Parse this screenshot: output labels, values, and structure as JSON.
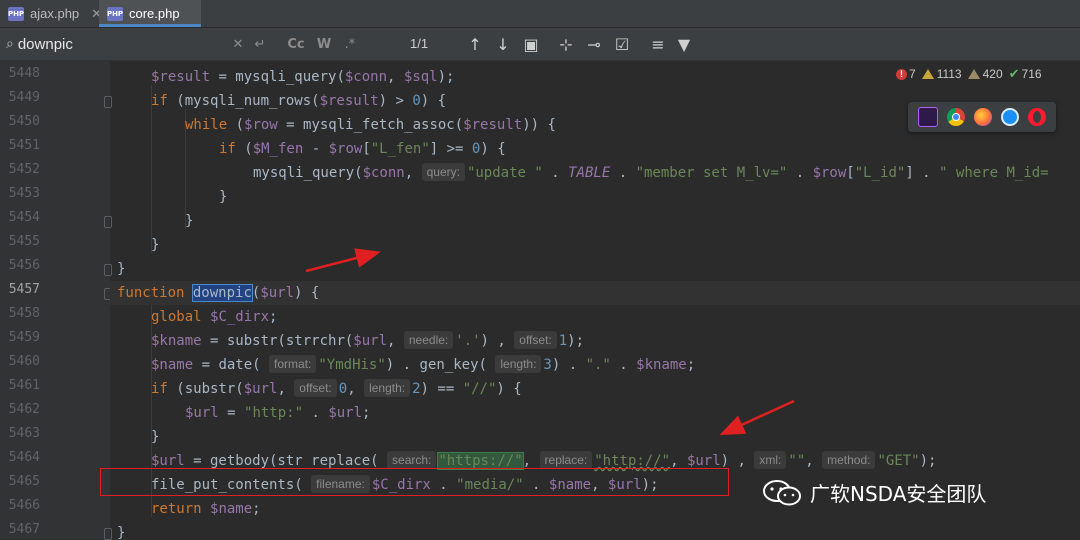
{
  "tabs": [
    {
      "icon_text": "PHP",
      "label": "ajax.php",
      "close": "✕",
      "active": false
    },
    {
      "icon_text": "PHP",
      "label": "core.php",
      "close": "",
      "active": true
    }
  ],
  "search": {
    "value": "downpic",
    "match_count": "1/1",
    "icons": [
      "search-icon",
      "clear-icon",
      "history-icon",
      "match-case-icon",
      "whole-words-icon",
      "regex-icon",
      "prev-occurrence-icon",
      "next-occurrence-icon",
      "select-all-icon",
      "add-selection-icon",
      "remove-selection-icon",
      "select-all-occurrences-icon",
      "multiline-icon",
      "filter-icon"
    ],
    "toggle_labels": {
      "match_case": "Cc",
      "whole_words": "W",
      "regex": ".*"
    }
  },
  "inspections": {
    "errors": "7",
    "warnings": "1113",
    "weak_warnings": "420",
    "typos": "716"
  },
  "browsers": [
    "phpstorm-icon",
    "chrome-icon",
    "firefox-icon",
    "safari-icon",
    "opera-icon"
  ],
  "line_numbers": [
    "5448",
    "5449",
    "5450",
    "5451",
    "5452",
    "5453",
    "5454",
    "5455",
    "5456",
    "5457",
    "5458",
    "5459",
    "5460",
    "5461",
    "5462",
    "5463",
    "5464",
    "5465",
    "5466",
    "5467"
  ],
  "current_line": "5457",
  "code": {
    "l5448": {
      "a": "$result",
      "b": " = mysqli_query(",
      "c": "$conn",
      "d": ", ",
      "e": "$sql",
      "f": ");"
    },
    "l5449": {
      "a": "if",
      "b": " (mysqli_num_rows(",
      "c": "$result",
      "d": ") > ",
      "e": "0",
      "f": ") {"
    },
    "l5450": {
      "a": "while",
      "b": " (",
      "c": "$row",
      "d": " = mysqli_fetch_assoc(",
      "e": "$result",
      "f": ")) {"
    },
    "l5451": {
      "a": "if",
      "b": " (",
      "c": "$M_fen",
      "d": " - ",
      "e": "$row",
      "f": "[",
      "g": "\"L_fen\"",
      "h": "] >= ",
      "i": "0",
      "j": ") {"
    },
    "l5452": {
      "a": "mysqli_query(",
      "b": "$conn",
      "c": ", ",
      "hint": "query:",
      "d": "\"update \"",
      "e": " . ",
      "f": "TABLE",
      "g": " . ",
      "h": "\"member set M_lv=\"",
      "i": " . ",
      "j": "$row",
      "k": "[",
      "l": "\"L_id\"",
      "m": "] . ",
      "n": "\" where M_id="
    },
    "l5453": {
      "a": "}"
    },
    "l5454": {
      "a": "}"
    },
    "l5455": {
      "a": "}"
    },
    "l5456": {
      "a": "}"
    },
    "l5457": {
      "a": "function",
      "b": " ",
      "c": "downpic",
      "d": "(",
      "e": "$url",
      "f": ") {"
    },
    "l5458": {
      "a": "global",
      "b": " ",
      "c": "$C_dirx",
      "d": ";"
    },
    "l5459": {
      "a": "$kname",
      "b": " = substr(strrchr(",
      "c": "$url",
      "d": ", ",
      "hint1": "needle:",
      "e": "'.'",
      "f": ") , ",
      "hint2": "offset:",
      "g": "1",
      "h": ");"
    },
    "l5460": {
      "a": "$name",
      "b": " = date( ",
      "hint1": "format:",
      "c": "\"YmdHis\"",
      "d": ") . gen_key( ",
      "hint2": "length:",
      "e": "3",
      "f": ") . ",
      "g": "\".\"",
      "h": " . ",
      "i": "$kname",
      "j": ";"
    },
    "l5461": {
      "a": "if",
      "b": " (substr(",
      "c": "$url",
      "d": ", ",
      "hint1": "offset:",
      "e": "0",
      "f": ", ",
      "hint2": "length:",
      "g": "2",
      "h": ") == ",
      "i": "\"//\"",
      "j": ") {"
    },
    "l5462": {
      "a": "$url",
      "b": " = ",
      "c": "\"http:\"",
      "d": " . ",
      "e": "$url",
      "f": ";"
    },
    "l5463": {
      "a": "}"
    },
    "l5464": {
      "a": "$url",
      "b": " = getbody(str_replace( ",
      "hint1": "search:",
      "c": "\"https://\"",
      "d": ", ",
      "hint2": "replace:",
      "e": "\"http://\"",
      "f": ", ",
      "g": "$url",
      "h": ") , ",
      "hint3": "xml:",
      "i": "\"\"",
      "j": ", ",
      "hint4": "method:",
      "k": "\"GET\"",
      "l": ");"
    },
    "l5465": {
      "a": "file_put_contents( ",
      "hint": "filename:",
      "b": "$C_dirx",
      "c": " . ",
      "d": "\"media/\"",
      "e": " . ",
      "f": "$name",
      "g": ", ",
      "h": "$url",
      "i": ");"
    },
    "l5466": {
      "a": "return",
      "b": " ",
      "c": "$name",
      "d": ";"
    },
    "l5467": {
      "a": "}"
    }
  },
  "watermark": {
    "text": "广软NSDA安全团队"
  },
  "colors": {
    "keyword": "#cc7832",
    "variable": "#9876aa",
    "string": "#6a8759",
    "number": "#6897bb",
    "annotation": "#e02020"
  }
}
